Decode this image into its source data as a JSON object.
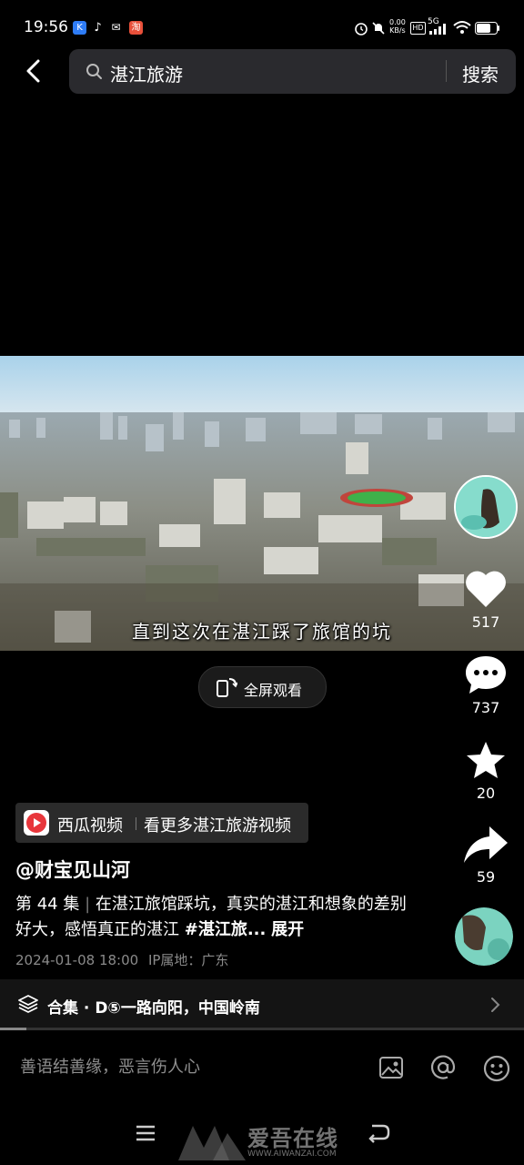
{
  "status_bar": {
    "time": "19:56",
    "net_speed_value": "0.00",
    "net_speed_unit": "KB/s",
    "hd": "HD",
    "network": "5G"
  },
  "search": {
    "query": "湛江旅游",
    "button_label": "搜索"
  },
  "video": {
    "subtitle": "直到这次在湛江踩了旅馆的坑",
    "fullscreen_label": "全屏观看",
    "progress": 0.05
  },
  "actions": {
    "likes": "517",
    "comments": "737",
    "favorites": "20",
    "shares": "59"
  },
  "xigua_banner": {
    "app_name": "西瓜视频",
    "link_text": "看更多湛江旅游视频"
  },
  "post": {
    "author": "@财宝见山河",
    "episode": "第 44 集",
    "description": "在湛江旅馆踩坑，真实的湛江和想象的差别好大，感悟真正的湛江",
    "hashtag": "#湛江旅...",
    "expand_label": "展开",
    "date": "2024-01-08 18:00",
    "ip_location": "IP属地：广东"
  },
  "collection": {
    "label": "合集",
    "title": "D⑤一路向阳，中国岭南"
  },
  "comment_bar": {
    "placeholder": "善语结善缘，恶言伤人心"
  },
  "watermark": {
    "text": "爱吾在线",
    "url": "WWW.AIWANZAI.COM"
  },
  "colors": {
    "background": "#000000",
    "search_bg": "#2a2a2e",
    "xigua_red": "#e8363b",
    "secondary_text": "#8a8a8a"
  }
}
